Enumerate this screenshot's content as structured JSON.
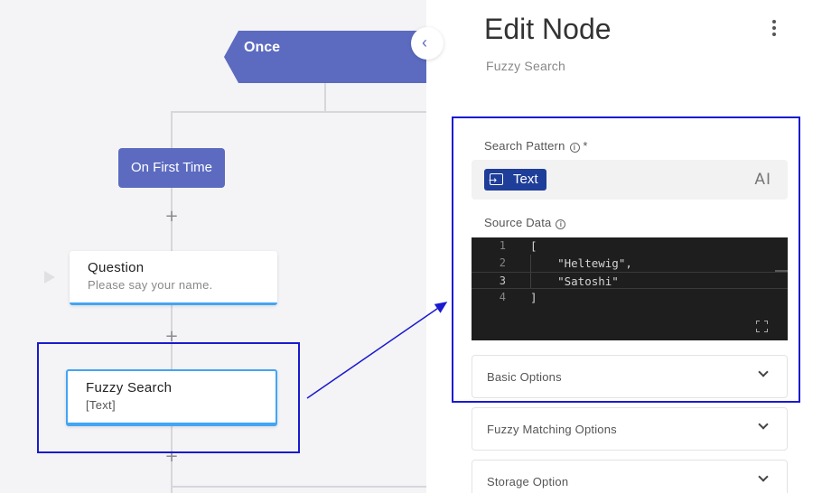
{
  "canvas": {
    "once_label": "Once",
    "first_time_label": "On First Time",
    "question_node": {
      "title": "Question",
      "subtitle": "Please say your name."
    },
    "fuzzy_node": {
      "title": "Fuzzy Search",
      "subtitle": "[Text]"
    },
    "plus_glyph": "+"
  },
  "panel": {
    "title": "Edit Node",
    "subtitle": "Fuzzy Search",
    "search_pattern": {
      "label": "Search Pattern",
      "required_marker": "*",
      "chip_label": "Text",
      "ai_label": "AI"
    },
    "source_data": {
      "label": "Source Data",
      "lines": [
        {
          "num": "1",
          "text": "["
        },
        {
          "num": "2",
          "text": "    \"Heltewig\","
        },
        {
          "num": "3",
          "text": "    \"Satoshi\""
        },
        {
          "num": "4",
          "text": "]"
        }
      ],
      "active_line": 3
    },
    "accordions": [
      {
        "label": "Basic Options"
      },
      {
        "label": "Fuzzy Matching Options"
      },
      {
        "label": "Storage Option"
      }
    ]
  },
  "icons": [
    "chevron-left-icon",
    "kebab-menu-icon",
    "info-icon",
    "text-input-icon",
    "ai-icon",
    "expand-icon",
    "chevron-down-icon",
    "play-icon",
    "plus-icon"
  ],
  "colors": {
    "node_purple": "#5c6bc0",
    "selection_blue": "#42a5f5",
    "chip_blue": "#1f3e99",
    "annotation_blue": "#1a1ad0",
    "editor_bg": "#1e1e1e",
    "string_color": "#ce9178"
  }
}
